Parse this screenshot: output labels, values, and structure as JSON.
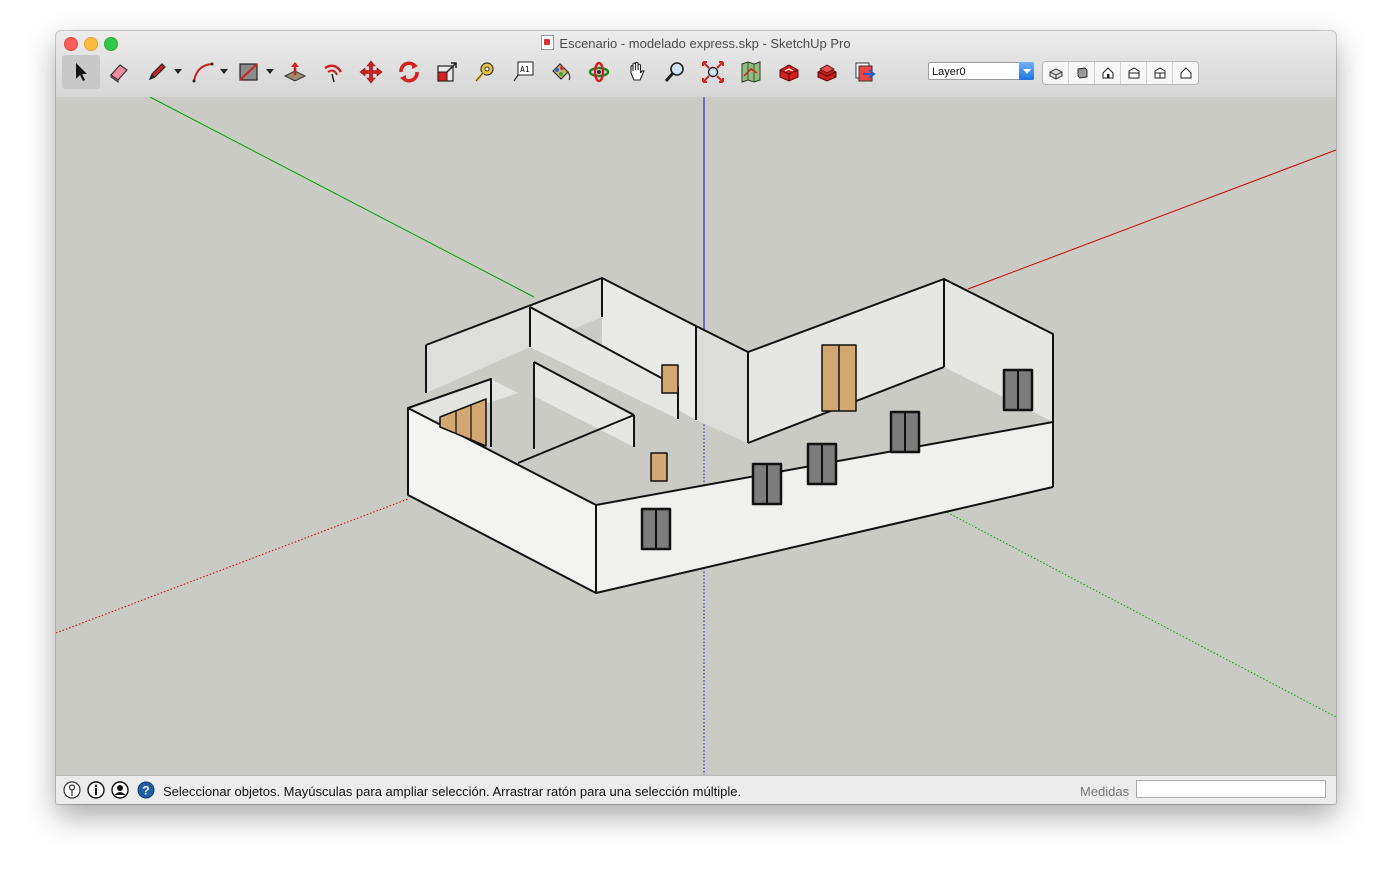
{
  "window": {
    "title": "Escenario - modelado express.skp - SketchUp Pro"
  },
  "toolbar": {
    "tools": [
      {
        "name": "select-tool",
        "icon": "arrow-cursor-icon"
      },
      {
        "name": "eraser-tool",
        "icon": "eraser-icon"
      },
      {
        "name": "line-tool",
        "icon": "pencil-icon"
      },
      {
        "name": "arc-tool",
        "icon": "arc-icon"
      },
      {
        "name": "rectangle-tool",
        "icon": "rectangle-icon"
      },
      {
        "name": "push-pull-tool",
        "icon": "push-pull-icon"
      },
      {
        "name": "offset-tool",
        "icon": "offset-icon"
      },
      {
        "name": "move-tool",
        "icon": "move-arrows-icon"
      },
      {
        "name": "rotate-tool",
        "icon": "rotate-icon"
      },
      {
        "name": "scale-tool",
        "icon": "scale-icon"
      },
      {
        "name": "tape-measure-tool",
        "icon": "tape-measure-icon"
      },
      {
        "name": "text-tool",
        "icon": "text-label-icon"
      },
      {
        "name": "paint-bucket-tool",
        "icon": "paint-bucket-icon"
      },
      {
        "name": "orbit-tool",
        "icon": "orbit-icon"
      },
      {
        "name": "pan-tool",
        "icon": "hand-icon"
      },
      {
        "name": "zoom-tool",
        "icon": "magnifier-icon"
      },
      {
        "name": "zoom-extents-tool",
        "icon": "zoom-extents-icon"
      },
      {
        "name": "add-location-tool",
        "icon": "map-location-icon"
      },
      {
        "name": "3d-warehouse-tool",
        "icon": "warehouse-icon"
      },
      {
        "name": "extension-warehouse-tool",
        "icon": "extension-warehouse-icon"
      },
      {
        "name": "send-to-layout-tool",
        "icon": "send-to-layout-icon"
      }
    ],
    "layer_text_label": "A1",
    "layer": "Layer0",
    "views": [
      {
        "name": "view-iso",
        "icon": "iso-view-icon"
      },
      {
        "name": "view-top",
        "icon": "top-view-icon"
      },
      {
        "name": "view-front",
        "icon": "front-view-icon"
      },
      {
        "name": "view-right",
        "icon": "right-view-icon"
      },
      {
        "name": "view-back",
        "icon": "back-view-icon"
      },
      {
        "name": "view-left",
        "icon": "left-view-icon"
      }
    ]
  },
  "colors": {
    "viewport_bg": "#cbcbc6",
    "wall_face": "#ececea",
    "door": "#d2a772",
    "window_glass": "#7c7c7c",
    "axis_red": "#cc0000",
    "axis_green": "#00a000",
    "axis_blue": "#1414c8"
  },
  "statusbar": {
    "message": "Seleccionar objetos. Mayúsculas para ampliar selección. Arrastrar ratón para una selección múltiple.",
    "measurements_label": "Medidas",
    "measurements_value": ""
  }
}
